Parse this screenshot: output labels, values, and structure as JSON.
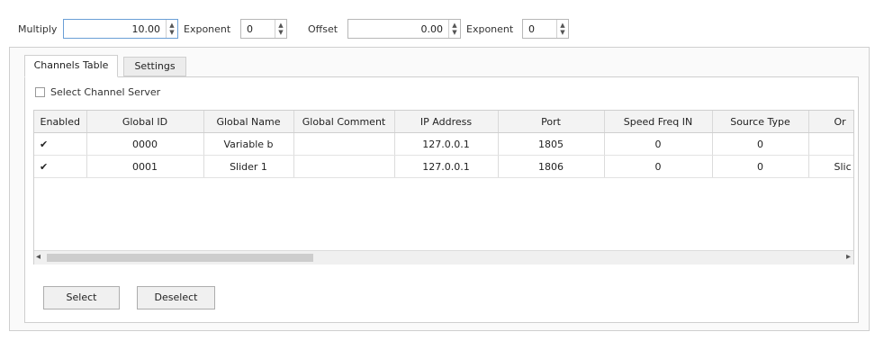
{
  "toolbar": {
    "multiply_label": "Multiply",
    "multiply_value": "10.00",
    "exponent_label_1": "Exponent",
    "exponent_value_1": "0",
    "offset_label": "Offset",
    "offset_value": "0.00",
    "exponent_label_2": "Exponent",
    "exponent_value_2": "0"
  },
  "tabs": [
    {
      "label": "Channels Table",
      "active": true
    },
    {
      "label": "Settings",
      "active": false
    }
  ],
  "select_channel_server_label": "Select Channel Server",
  "table": {
    "columns": [
      "Enabled",
      "Global ID",
      "Global Name",
      "Global Comment",
      "IP Address",
      "Port",
      "Speed Freq IN",
      "Source Type",
      "Or"
    ],
    "rows": [
      {
        "enabled": true,
        "global_id": "0000",
        "global_name": "Variable b",
        "global_comment": "",
        "ip": "127.0.0.1",
        "port": "1805",
        "speed": "0",
        "source_type": "0",
        "or": ""
      },
      {
        "enabled": true,
        "global_id": "0001",
        "global_name": "Slider 1",
        "global_comment": "",
        "ip": "127.0.0.1",
        "port": "1806",
        "speed": "0",
        "source_type": "0",
        "or": "Slic"
      }
    ]
  },
  "buttons": {
    "select": "Select",
    "deselect": "Deselect"
  },
  "icons": {
    "check": "✔",
    "spin_up": "▲",
    "spin_down": "▼",
    "scroll_left": "◂",
    "scroll_right": "▸"
  }
}
